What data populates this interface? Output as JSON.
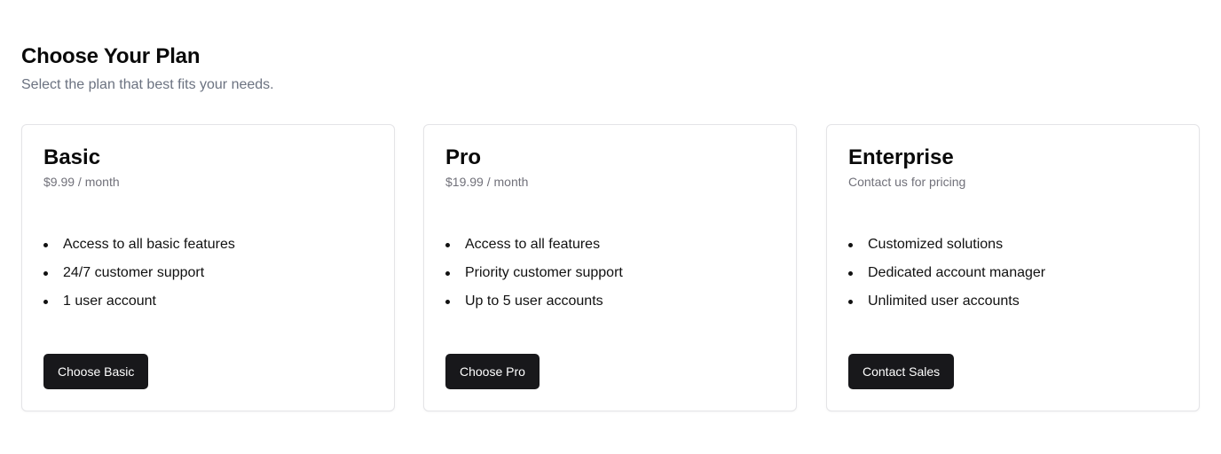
{
  "header": {
    "title": "Choose Your Plan",
    "subtitle": "Select the plan that best fits your needs."
  },
  "plans": [
    {
      "name": "Basic",
      "price": "$9.99 / month",
      "features": [
        "Access to all basic features",
        "24/7 customer support",
        "1 user account"
      ],
      "button": "Choose Basic"
    },
    {
      "name": "Pro",
      "price": "$19.99 / month",
      "features": [
        "Access to all features",
        "Priority customer support",
        "Up to 5 user accounts"
      ],
      "button": "Choose Pro"
    },
    {
      "name": "Enterprise",
      "price": "Contact us for pricing",
      "features": [
        "Customized solutions",
        "Dedicated account manager",
        "Unlimited user accounts"
      ],
      "button": "Contact Sales"
    }
  ],
  "colors": {
    "button_bg": "#18181b",
    "button_text": "#ffffff",
    "muted_text": "#71717a",
    "border": "#e4e4e7"
  }
}
